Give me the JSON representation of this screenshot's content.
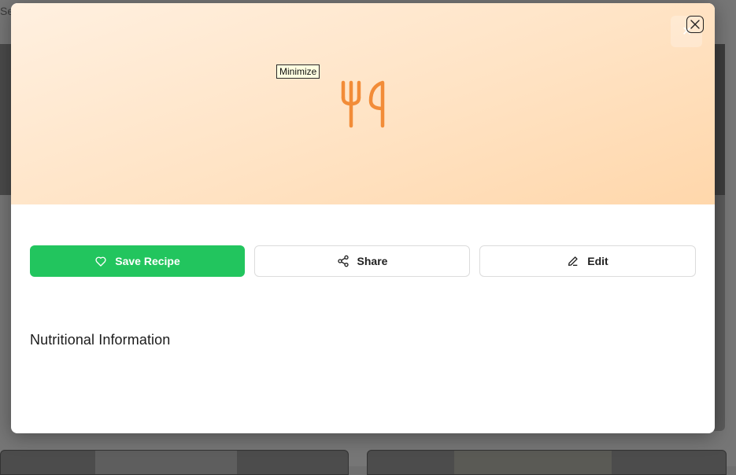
{
  "background": {
    "top_text": "Se"
  },
  "modal": {
    "tooltip": "Minimize",
    "actions": {
      "save_label": "Save Recipe",
      "share_label": "Share",
      "edit_label": "Edit"
    },
    "section_title": "Nutritional Information",
    "icons": {
      "hero": "utensils-icon",
      "close": "close-icon",
      "save": "heart-icon",
      "share": "share-icon",
      "edit": "pencil-icon"
    },
    "colors": {
      "save_button": "#22c55e",
      "hero_icon": "#f28c38",
      "hero_gradient_start": "#fff0e0",
      "hero_gradient_end": "#ffd7ab"
    }
  }
}
